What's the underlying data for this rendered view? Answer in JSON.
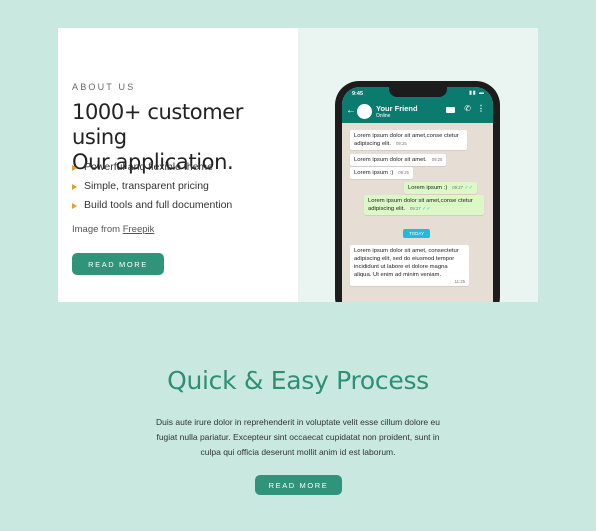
{
  "about": {
    "eyebrow": "ABOUT US",
    "headline_line1": "1000+ customer using",
    "headline_line2": "Our application.",
    "features": [
      "Powerful and flexible theme",
      "Simple, transparent pricing",
      "Build tools and full documention"
    ],
    "credit_prefix": "Image from",
    "credit_link": "Freepik",
    "button_label": "READ MORE"
  },
  "phone": {
    "time": "9:45",
    "contact_name": "Your Friend",
    "contact_status": "Online",
    "messages": [
      {
        "text": "Lorem ipsum dolor sit amet,conse ctetur adipiscing elit.",
        "time": "09:25",
        "direction": "in"
      },
      {
        "text": "Lorem ipsum dolor sit amet.",
        "time": "09:25",
        "direction": "in"
      },
      {
        "text": "Lorem ipsum :)",
        "time": "09:25",
        "direction": "in"
      },
      {
        "text": "Lorem ipsum :)",
        "time": "09:27",
        "direction": "out"
      },
      {
        "text": "Lorem ipsum dolor sit amet,conse ctetur adipiscing elit.",
        "time": "09:27",
        "direction": "out"
      },
      {
        "text": "Lorem ipsum dolor sit amet, consectetur adipiscing elit, sed do eiusmod tempor incididunt ut labore et dolore magna aliqua. Ut enim ad minim veniam.",
        "time": "11:25",
        "direction": "in"
      }
    ],
    "date_chip": "TODAY"
  },
  "process": {
    "title": "Quick & Easy Process",
    "text": "Duis aute irure dolor in reprehenderit in voluptate velit esse cillum dolore eu fugiat nulla pariatur. Excepteur sint occaecat cupidatat non proident, sunt in culpa qui officia deserunt mollit anim id est laborum.",
    "button_label": "READ MORE"
  },
  "colors": {
    "page_background": "#c9e9e0",
    "accent": "#2f9479",
    "title": "#2f8f74",
    "bullet": "#e0a030",
    "whatsapp_header": "#0b7b6f"
  }
}
